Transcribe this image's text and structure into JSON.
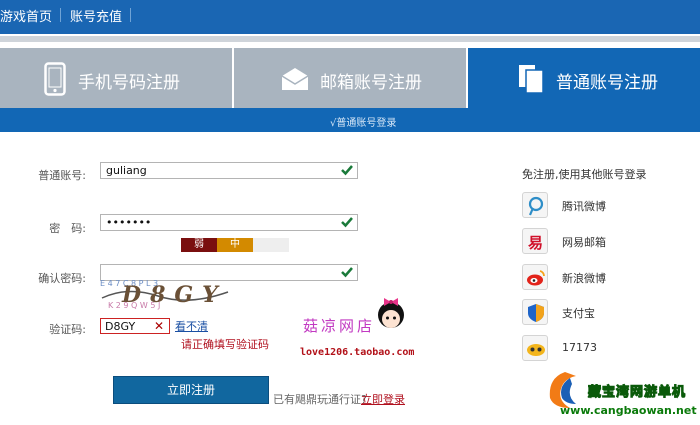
{
  "topnav": {
    "home": "游戏首页",
    "recharge": "账号充值"
  },
  "tabs": [
    {
      "label": "手机号码注册",
      "icon": "phone-icon"
    },
    {
      "label": "邮箱账号注册",
      "icon": "envelope-icon"
    },
    {
      "label": "普通账号注册",
      "icon": "document-icon",
      "active": true
    }
  ],
  "subtab_text": "√普通账号登录",
  "form": {
    "username_label": "普通账号:",
    "username_value": "guliang",
    "password_label": "密　码:",
    "password_value": "•••••••",
    "strength_weak": "弱",
    "strength_mid": "中",
    "confirm_label": "确认密码:",
    "captcha_label": "验证码:",
    "captcha_value": "D8GY",
    "captcha_image_text": "D8GY",
    "captcha_refresh": "看不清",
    "captcha_error": "请正确填写验证码",
    "submit": "立即注册",
    "have_account_hint": "已有飓鼎玩通行证?",
    "login_link": "立即登录"
  },
  "third_party": {
    "title": "免注册,使用其他账号登录",
    "items": [
      {
        "label": "腾讯微博",
        "icon": "tencent-weibo-icon"
      },
      {
        "label": "网易邮箱",
        "icon": "netease-mail-icon"
      },
      {
        "label": "新浪微博",
        "icon": "sina-weibo-icon"
      },
      {
        "label": "支付宝",
        "icon": "alipay-icon"
      },
      {
        "label": "17173",
        "icon": "17173-icon"
      }
    ]
  },
  "watermarks": {
    "shop_name": "菇凉网店",
    "shop_url": "love1206.taobao.com",
    "brand_name": "藏宝湾网游单机",
    "brand_url": "www.cangbaowan.net"
  },
  "colors": {
    "primary_blue": "#1267b5",
    "tab_grey": "#a9b4bf",
    "check_green": "#1a7a3a",
    "error_red": "#b0101e"
  }
}
